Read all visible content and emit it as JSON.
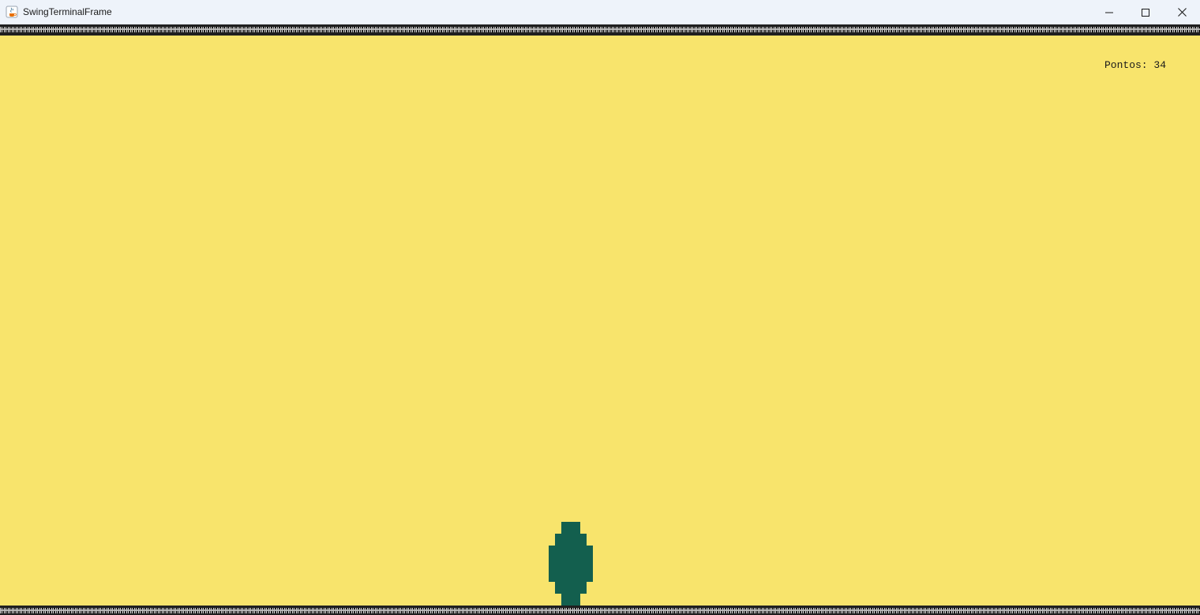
{
  "window": {
    "title": "SwingTerminalFrame",
    "icon": "java-coffee-icon",
    "controls": {
      "minimize": "minimize-icon",
      "maximize": "maximize-icon",
      "close": "close-icon"
    }
  },
  "game": {
    "background_color": "#f8e46c",
    "border_char": "#",
    "score": {
      "label": "Pontos:",
      "value": "34"
    },
    "player": {
      "sprite": "player-sprite",
      "color": "#135f4e"
    }
  }
}
